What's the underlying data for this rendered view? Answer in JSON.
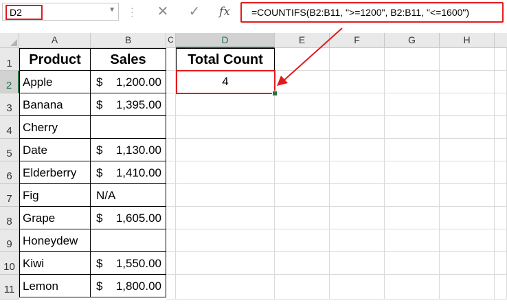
{
  "name_box": {
    "value": "D2"
  },
  "formula_bar": {
    "cancel_icon": "close-icon",
    "enter_icon": "check-icon",
    "fx_label": "fx",
    "formula": "=COUNTIFS(B2:B11, \">=1200\", B2:B11, \"<=1600\")"
  },
  "columns": [
    "A",
    "B",
    "C",
    "D",
    "E",
    "F",
    "G",
    "H"
  ],
  "rows": [
    "1",
    "2",
    "3",
    "4",
    "5",
    "6",
    "7",
    "8",
    "9",
    "10",
    "11"
  ],
  "table": {
    "headers": {
      "product": "Product",
      "sales": "Sales"
    },
    "rows": [
      {
        "product": "Apple",
        "currency": "$",
        "amount": "1,200.00",
        "text": ""
      },
      {
        "product": "Banana",
        "currency": "$",
        "amount": "1,395.00",
        "text": ""
      },
      {
        "product": "Cherry",
        "currency": "",
        "amount": "",
        "text": ""
      },
      {
        "product": "Date",
        "currency": "$",
        "amount": "1,130.00",
        "text": ""
      },
      {
        "product": "Elderberry",
        "currency": "$",
        "amount": "1,410.00",
        "text": ""
      },
      {
        "product": "Fig",
        "currency": "",
        "amount": "",
        "text": "N/A"
      },
      {
        "product": "Grape",
        "currency": "$",
        "amount": "1,605.00",
        "text": ""
      },
      {
        "product": "Honeydew",
        "currency": "",
        "amount": "",
        "text": ""
      },
      {
        "product": "Kiwi",
        "currency": "$",
        "amount": "1,550.00",
        "text": ""
      },
      {
        "product": "Lemon",
        "currency": "$",
        "amount": "1,800.00",
        "text": ""
      }
    ]
  },
  "summary": {
    "header": "Total Count",
    "value": "4"
  },
  "colors": {
    "highlight": "#e31a1c",
    "excel_green": "#217346"
  }
}
